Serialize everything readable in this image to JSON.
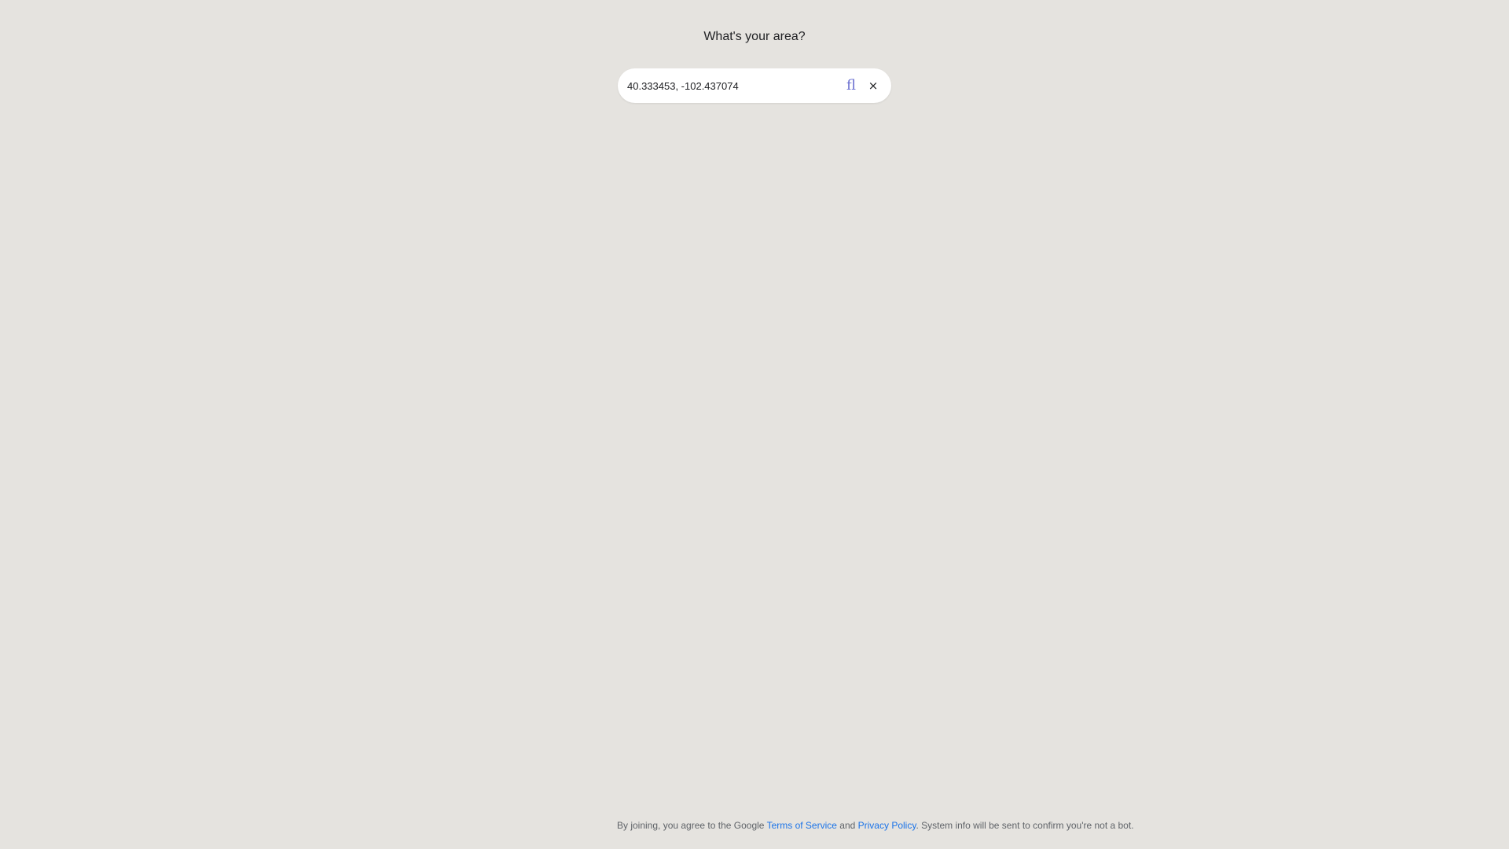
{
  "prompt": {
    "title": "What's your area?"
  },
  "search": {
    "value": "40.333453, -102.437074",
    "search_icon_glyph": "ﬂ",
    "clear_icon_glyph": "×",
    "icons": {
      "search": "search-icon",
      "clear": "close-icon"
    }
  },
  "footer": {
    "prefix": "By joining, you agree to the Google ",
    "terms_link": "Terms of Service",
    "middle": " and ",
    "privacy_link": "Privacy Policy",
    "suffix": ". System info will be sent to confirm you're not a bot."
  },
  "colors": {
    "background": "#e5e3df",
    "link": "#1a73e8",
    "search_icon": "#6a6fd0"
  }
}
